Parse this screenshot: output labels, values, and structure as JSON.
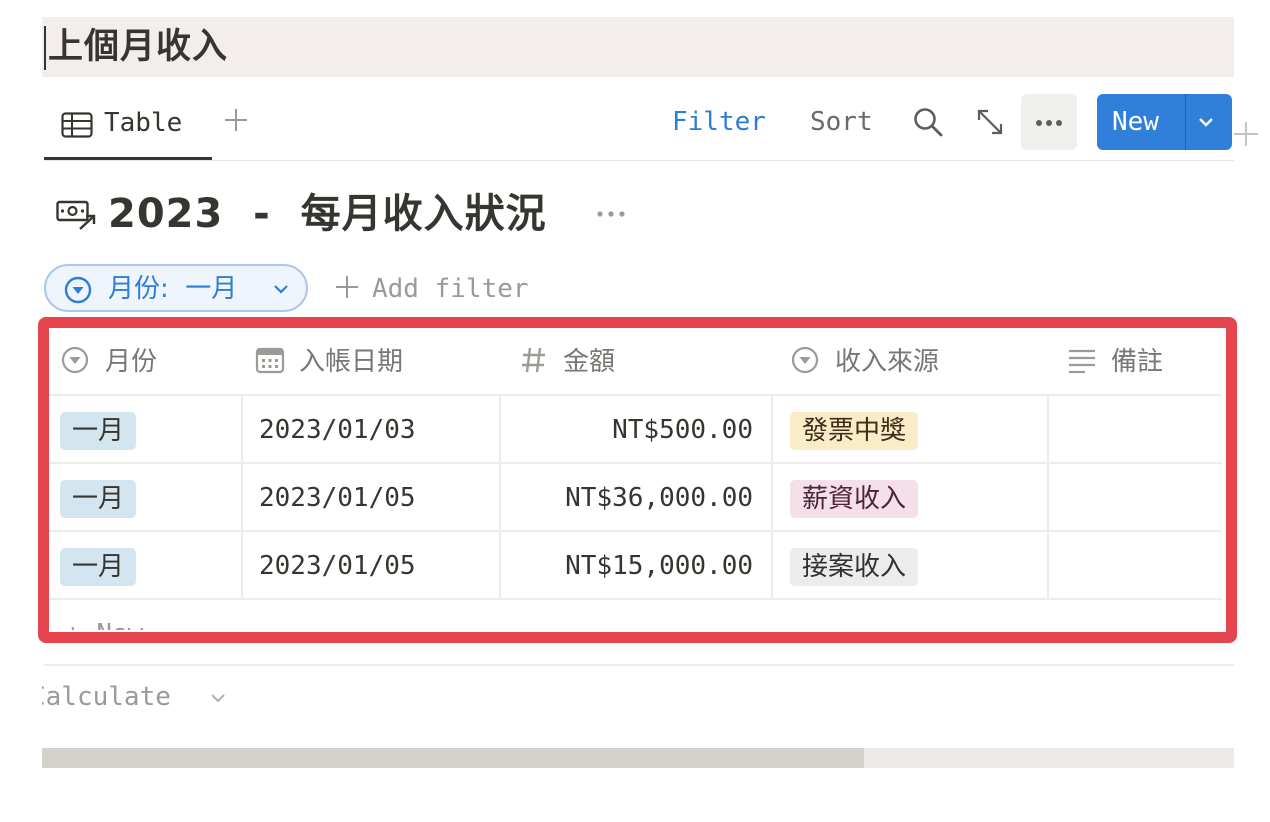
{
  "page": {
    "heading": "上個月收入"
  },
  "toolbar": {
    "view_tab_label": "Table",
    "filter_label": "Filter",
    "sort_label": "Sort",
    "new_label": "New"
  },
  "database": {
    "icon": "money-transfer-icon",
    "title": "2023  -  每月收入狀況"
  },
  "filters": {
    "active_chip": "月份:  一月",
    "add_filter_label": "Add filter"
  },
  "table": {
    "columns": [
      {
        "label": "月份",
        "icon": "select-icon"
      },
      {
        "label": "入帳日期",
        "icon": "calendar-icon"
      },
      {
        "label": "金額",
        "icon": "hash-icon"
      },
      {
        "label": "收入來源",
        "icon": "select-icon"
      },
      {
        "label": "備註",
        "icon": "text-lines-icon"
      }
    ],
    "rows": [
      {
        "month": "一月",
        "date": "2023/01/03",
        "amount": "NT$500.00",
        "source": "發票中獎",
        "source_color": "#fbecc8",
        "note": ""
      },
      {
        "month": "一月",
        "date": "2023/01/05",
        "amount": "NT$36,000.00",
        "source": "薪資收入",
        "source_color": "#f5e0e9",
        "note": ""
      },
      {
        "month": "一月",
        "date": "2023/01/05",
        "amount": "NT$15,000.00",
        "source": "接案收入",
        "source_color": "#ebeced",
        "note": ""
      }
    ],
    "new_row_label": "New"
  },
  "footer": {
    "calculate_label": "Calculate"
  },
  "scrollbar": {
    "position_fraction": 0.69
  },
  "colors": {
    "accent_blue": "#2f7fdb",
    "highlight_red": "#e5454c",
    "heading_bg": "#f3eeec"
  }
}
